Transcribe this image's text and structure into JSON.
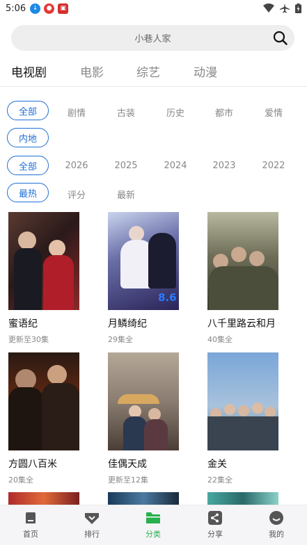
{
  "status_bar": {
    "time": "5:06",
    "icons": [
      "download-icon",
      "app-icon",
      "game-icon",
      "wifi-icon",
      "airplane-icon",
      "battery-icon"
    ]
  },
  "search": {
    "placeholder": "小巷人家"
  },
  "top_tabs": [
    "电视剧",
    "电影",
    "综艺",
    "动漫"
  ],
  "filters": {
    "genre": {
      "selected": "全部",
      "options": [
        "剧情",
        "古装",
        "历史",
        "都市",
        "爱情"
      ],
      "second_line": "内地"
    },
    "year": {
      "selected": "全部",
      "options": [
        "2026",
        "2025",
        "2024",
        "2023",
        "2022"
      ]
    },
    "sort": {
      "selected": "最热",
      "options": [
        "评分",
        "最新"
      ]
    }
  },
  "shows": [
    {
      "title": "蜜语纪",
      "status": "更新至30集"
    },
    {
      "title": "月鳞绮纪",
      "status": "29集全"
    },
    {
      "title": "八千里路云和月",
      "status": "40集全"
    },
    {
      "title": "方圆八百米",
      "status": "20集全"
    },
    {
      "title": "佳偶天成",
      "status": "更新至12集"
    },
    {
      "title": "金关",
      "status": "22集全"
    }
  ],
  "bottom_nav": [
    {
      "label": "首页",
      "icon": "home-icon"
    },
    {
      "label": "排行",
      "icon": "ranking-icon"
    },
    {
      "label": "分类",
      "icon": "folder-icon"
    },
    {
      "label": "分享",
      "icon": "share-icon"
    },
    {
      "label": "我的",
      "icon": "profile-icon"
    }
  ],
  "colors": {
    "accent_blue": "#1f6fd6",
    "active_green": "#27b04d"
  }
}
